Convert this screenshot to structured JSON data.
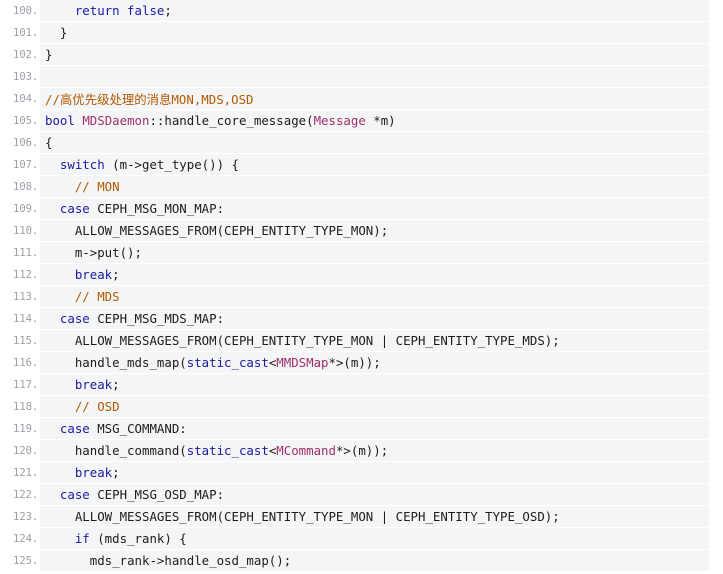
{
  "lines": [
    {
      "num": "100.",
      "indent": 2,
      "tokens": [
        {
          "t": "return false",
          "c": "kw"
        },
        {
          "t": ";",
          "c": "plain"
        }
      ]
    },
    {
      "num": "101.",
      "indent": 1,
      "tokens": [
        {
          "t": "}",
          "c": "plain"
        }
      ]
    },
    {
      "num": "102.",
      "indent": 0,
      "tokens": [
        {
          "t": "}",
          "c": "plain"
        }
      ]
    },
    {
      "num": "103.",
      "indent": 0,
      "tokens": []
    },
    {
      "num": "104.",
      "indent": 0,
      "tokens": [
        {
          "t": "//高优先级处理的消息MON,MDS,OSD",
          "c": "comment"
        }
      ]
    },
    {
      "num": "105.",
      "indent": 0,
      "tokens": [
        {
          "t": "bool",
          "c": "type"
        },
        {
          "t": " ",
          "c": "plain"
        },
        {
          "t": "MDSDaemon",
          "c": "class"
        },
        {
          "t": "::handle_core_message(",
          "c": "plain"
        },
        {
          "t": "Message",
          "c": "class"
        },
        {
          "t": " *m)",
          "c": "plain"
        }
      ]
    },
    {
      "num": "106.",
      "indent": 0,
      "tokens": [
        {
          "t": "{",
          "c": "plain"
        }
      ]
    },
    {
      "num": "107.",
      "indent": 1,
      "tokens": [
        {
          "t": "switch",
          "c": "kw"
        },
        {
          "t": " (m->get_type()) {",
          "c": "plain"
        }
      ]
    },
    {
      "num": "108.",
      "indent": 2,
      "tokens": [
        {
          "t": "// MON",
          "c": "comment"
        }
      ]
    },
    {
      "num": "109.",
      "indent": 1,
      "tokens": [
        {
          "t": "case",
          "c": "kw"
        },
        {
          "t": " CEPH_MSG_MON_MAP:",
          "c": "plain"
        }
      ]
    },
    {
      "num": "110.",
      "indent": 2,
      "tokens": [
        {
          "t": "ALLOW_MESSAGES_FROM(CEPH_ENTITY_TYPE_MON);",
          "c": "plain"
        }
      ]
    },
    {
      "num": "111.",
      "indent": 2,
      "tokens": [
        {
          "t": "m->put();",
          "c": "plain"
        }
      ]
    },
    {
      "num": "112.",
      "indent": 2,
      "tokens": [
        {
          "t": "break",
          "c": "kw"
        },
        {
          "t": ";",
          "c": "plain"
        }
      ]
    },
    {
      "num": "113.",
      "indent": 2,
      "tokens": [
        {
          "t": "// MDS",
          "c": "comment"
        }
      ]
    },
    {
      "num": "114.",
      "indent": 1,
      "tokens": [
        {
          "t": "case",
          "c": "kw"
        },
        {
          "t": " CEPH_MSG_MDS_MAP:",
          "c": "plain"
        }
      ]
    },
    {
      "num": "115.",
      "indent": 2,
      "tokens": [
        {
          "t": "ALLOW_MESSAGES_FROM(CEPH_ENTITY_TYPE_MON | CEPH_ENTITY_TYPE_MDS);",
          "c": "plain"
        }
      ]
    },
    {
      "num": "116.",
      "indent": 2,
      "tokens": [
        {
          "t": "handle_mds_map(",
          "c": "plain"
        },
        {
          "t": "static_cast",
          "c": "kw"
        },
        {
          "t": "<",
          "c": "plain"
        },
        {
          "t": "MMDSMap",
          "c": "class"
        },
        {
          "t": "*>(m));",
          "c": "plain"
        }
      ]
    },
    {
      "num": "117.",
      "indent": 2,
      "tokens": [
        {
          "t": "break",
          "c": "kw"
        },
        {
          "t": ";",
          "c": "plain"
        }
      ]
    },
    {
      "num": "118.",
      "indent": 2,
      "tokens": [
        {
          "t": "// OSD",
          "c": "comment"
        }
      ]
    },
    {
      "num": "119.",
      "indent": 1,
      "tokens": [
        {
          "t": "case",
          "c": "kw"
        },
        {
          "t": " MSG_COMMAND:",
          "c": "plain"
        }
      ]
    },
    {
      "num": "120.",
      "indent": 2,
      "tokens": [
        {
          "t": "handle_command(",
          "c": "plain"
        },
        {
          "t": "static_cast",
          "c": "kw"
        },
        {
          "t": "<",
          "c": "plain"
        },
        {
          "t": "MCommand",
          "c": "class"
        },
        {
          "t": "*>(m));",
          "c": "plain"
        }
      ]
    },
    {
      "num": "121.",
      "indent": 2,
      "tokens": [
        {
          "t": "break",
          "c": "kw"
        },
        {
          "t": ";",
          "c": "plain"
        }
      ]
    },
    {
      "num": "122.",
      "indent": 1,
      "tokens": [
        {
          "t": "case",
          "c": "kw"
        },
        {
          "t": " CEPH_MSG_OSD_MAP:",
          "c": "plain"
        }
      ]
    },
    {
      "num": "123.",
      "indent": 2,
      "tokens": [
        {
          "t": "ALLOW_MESSAGES_FROM(CEPH_ENTITY_TYPE_MON | CEPH_ENTITY_TYPE_OSD);",
          "c": "plain"
        }
      ]
    },
    {
      "num": "124.",
      "indent": 2,
      "tokens": [
        {
          "t": "if",
          "c": "kw"
        },
        {
          "t": " (mds_rank) {",
          "c": "plain"
        }
      ]
    },
    {
      "num": "125.",
      "indent": 3,
      "tokens": [
        {
          "t": "mds_rank->handle_osd_map();",
          "c": "plain"
        }
      ]
    }
  ],
  "colors": {
    "keyword": "#1a1a9e",
    "comment": "#b35a00",
    "class": "#a0306a",
    "line_number": "#9aa0a6",
    "code_background": "#f4f5f7"
  }
}
